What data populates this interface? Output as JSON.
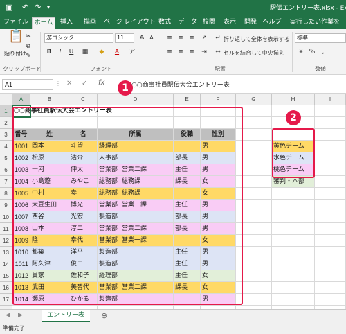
{
  "title": "駅伝エントリー表.xlsx - Excel",
  "ribbon_tabs": [
    "ファイル",
    "ホーム",
    "挿入",
    "描画",
    "ページ レイアウト",
    "数式",
    "データ",
    "校閲",
    "表示",
    "開発",
    "ヘルプ",
    "実行したい作業を"
  ],
  "active_tab": "ホーム",
  "ribbon": {
    "paste": "貼り付け",
    "clipboard_group": "クリップボード",
    "font_name": "游ゴシック",
    "font_size": "11",
    "font_group": "フォント",
    "wrap_text": "折り返して全体を表示する",
    "merge_center": "セルを結合して中央揃え",
    "align_group": "配置",
    "number_format": "標準",
    "number_group": "数値"
  },
  "name_box": "A1",
  "formula_content": "○○商事社員駅伝大会エントリー表",
  "columns": [
    "A",
    "B",
    "C",
    "D",
    "E",
    "F",
    "G",
    "H",
    "I"
  ],
  "rows": [
    "1",
    "2",
    "3",
    "4",
    "5",
    "6",
    "7",
    "8",
    "9",
    "10",
    "11",
    "12",
    "13",
    "14",
    "15",
    "16",
    "17",
    "18"
  ],
  "table": {
    "title": "○○商事社員駅伝大会エントリー表",
    "headers": [
      "番号",
      "姓",
      "名",
      "所属",
      "",
      "役職",
      "性別"
    ],
    "entries": [
      {
        "no": "1001",
        "sei": "岡本",
        "mei": "斗望",
        "dept": "経理部",
        "sect": "",
        "pos": "",
        "sex": "男",
        "team": "yellow"
      },
      {
        "no": "1002",
        "sei": "松原",
        "mei": "浩介",
        "dept": "人事部",
        "sect": "",
        "pos": "部長",
        "sex": "男",
        "team": "blue"
      },
      {
        "no": "1003",
        "sei": "十河",
        "mei": "伸太",
        "dept": "営業部",
        "sect": "営業二課",
        "pos": "主任",
        "sex": "男",
        "team": "pink"
      },
      {
        "no": "1004",
        "sei": "小島遊",
        "mei": "みやこ",
        "dept": "総務部",
        "sect": "総務課",
        "pos": "課長",
        "sex": "女",
        "team": "pink"
      },
      {
        "no": "1005",
        "sei": "中村",
        "mei": "奏",
        "dept": "総務部",
        "sect": "総務課",
        "pos": "",
        "sex": "女",
        "team": "yellow"
      },
      {
        "no": "1006",
        "sei": "大豆生田",
        "mei": "博光",
        "dept": "営業部",
        "sect": "営業一課",
        "pos": "主任",
        "sex": "男",
        "team": "pink"
      },
      {
        "no": "1007",
        "sei": "西谷",
        "mei": "光宏",
        "dept": "製造部",
        "sect": "",
        "pos": "部長",
        "sex": "男",
        "team": "blue"
      },
      {
        "no": "1008",
        "sei": "山本",
        "mei": "淳二",
        "dept": "営業部",
        "sect": "営業二課",
        "pos": "部長",
        "sex": "男",
        "team": "pink"
      },
      {
        "no": "1009",
        "sei": "陰",
        "mei": "幸代",
        "dept": "営業部",
        "sect": "営業一課",
        "pos": "",
        "sex": "女",
        "team": "yellow"
      },
      {
        "no": "1010",
        "sei": "都築",
        "mei": "洋平",
        "dept": "製造部",
        "sect": "",
        "pos": "主任",
        "sex": "男",
        "team": "blue"
      },
      {
        "no": "1011",
        "sei": "阿久津",
        "mei": "俊二",
        "dept": "製造部",
        "sect": "",
        "pos": "主任",
        "sex": "男",
        "team": "blue"
      },
      {
        "no": "1012",
        "sei": "貴家",
        "mei": "佐和子",
        "dept": "経理部",
        "sect": "",
        "pos": "主任",
        "sex": "女",
        "team": "green"
      },
      {
        "no": "1013",
        "sei": "武田",
        "mei": "美智代",
        "dept": "営業部",
        "sect": "営業二課",
        "pos": "課長",
        "sex": "女",
        "team": "yellow"
      },
      {
        "no": "1014",
        "sei": "瀬原",
        "mei": "ひかる",
        "dept": "製造部",
        "sect": "",
        "pos": "",
        "sex": "男",
        "team": "pink"
      }
    ]
  },
  "legend": [
    {
      "label": "黄色チーム",
      "team": "yellow"
    },
    {
      "label": "水色チーム",
      "team": "blue"
    },
    {
      "label": "桃色チーム",
      "team": "pink"
    },
    {
      "label": "審判・本部",
      "team": "green"
    }
  ],
  "team_colors": {
    "yellow": "#ffd966",
    "blue": "#dde4f5",
    "pink": "#f9ccf5",
    "green": "#e2efd9"
  },
  "annotations": [
    "1",
    "2"
  ],
  "sheet_tab": "エントリー表",
  "status": "準備完了",
  "accent_color": "#217346",
  "highlight_color": "#e5194a"
}
